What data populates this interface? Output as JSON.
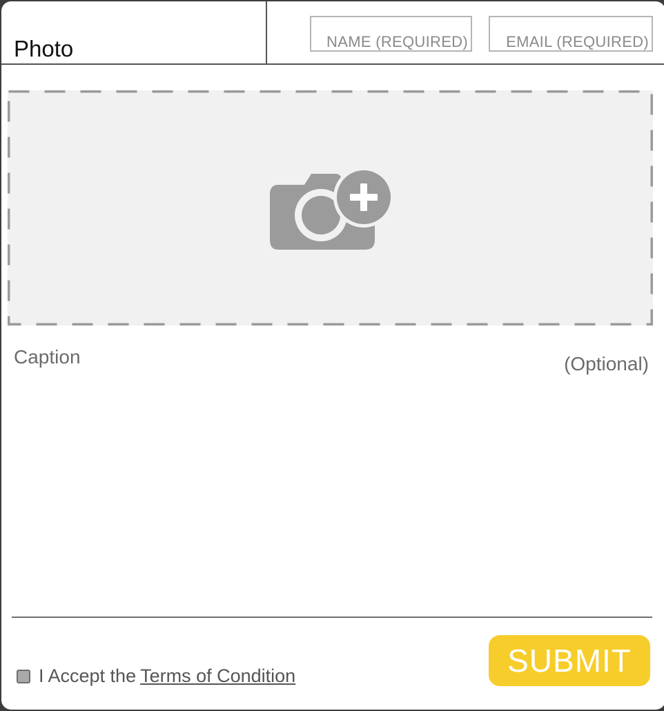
{
  "header": {
    "title": "Photo",
    "name_placeholder": "NAME (REQUIRED)",
    "email_placeholder": "EMAIL (REQUIRED)"
  },
  "upload": {
    "icon": "camera-add-icon"
  },
  "caption": {
    "label": "Caption",
    "optional": "(Optional)",
    "value": ""
  },
  "footer": {
    "accept_text": "I Accept the",
    "terms_link": "Terms of Condition",
    "submit_label": "SUBMIT"
  },
  "colors": {
    "accent": "#f6cd2a",
    "upload_bg": "#f1f1f1",
    "icon": "#999999",
    "border": "#555555"
  }
}
